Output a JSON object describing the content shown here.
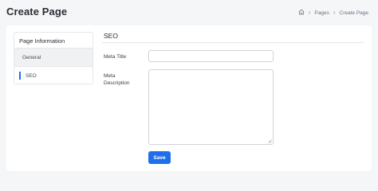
{
  "header": {
    "title": "Create Page",
    "breadcrumb": {
      "home_icon": "home-icon",
      "items": [
        "Pages",
        "Create Page"
      ],
      "separator": "›"
    }
  },
  "sidebar": {
    "header": "Page Information",
    "items": [
      {
        "label": "General",
        "active": false
      },
      {
        "label": "SEO",
        "active": true
      }
    ]
  },
  "main": {
    "section_title": "SEO",
    "fields": {
      "meta_title": {
        "label": "Meta Title",
        "value": ""
      },
      "meta_description": {
        "label_line1": "Meta",
        "label_line2": "Description",
        "value": ""
      }
    },
    "save_label": "Save"
  },
  "colors": {
    "accent": "#1f6feb",
    "background": "#f5f6f8",
    "card": "#ffffff",
    "border": "#e4e6ea"
  }
}
